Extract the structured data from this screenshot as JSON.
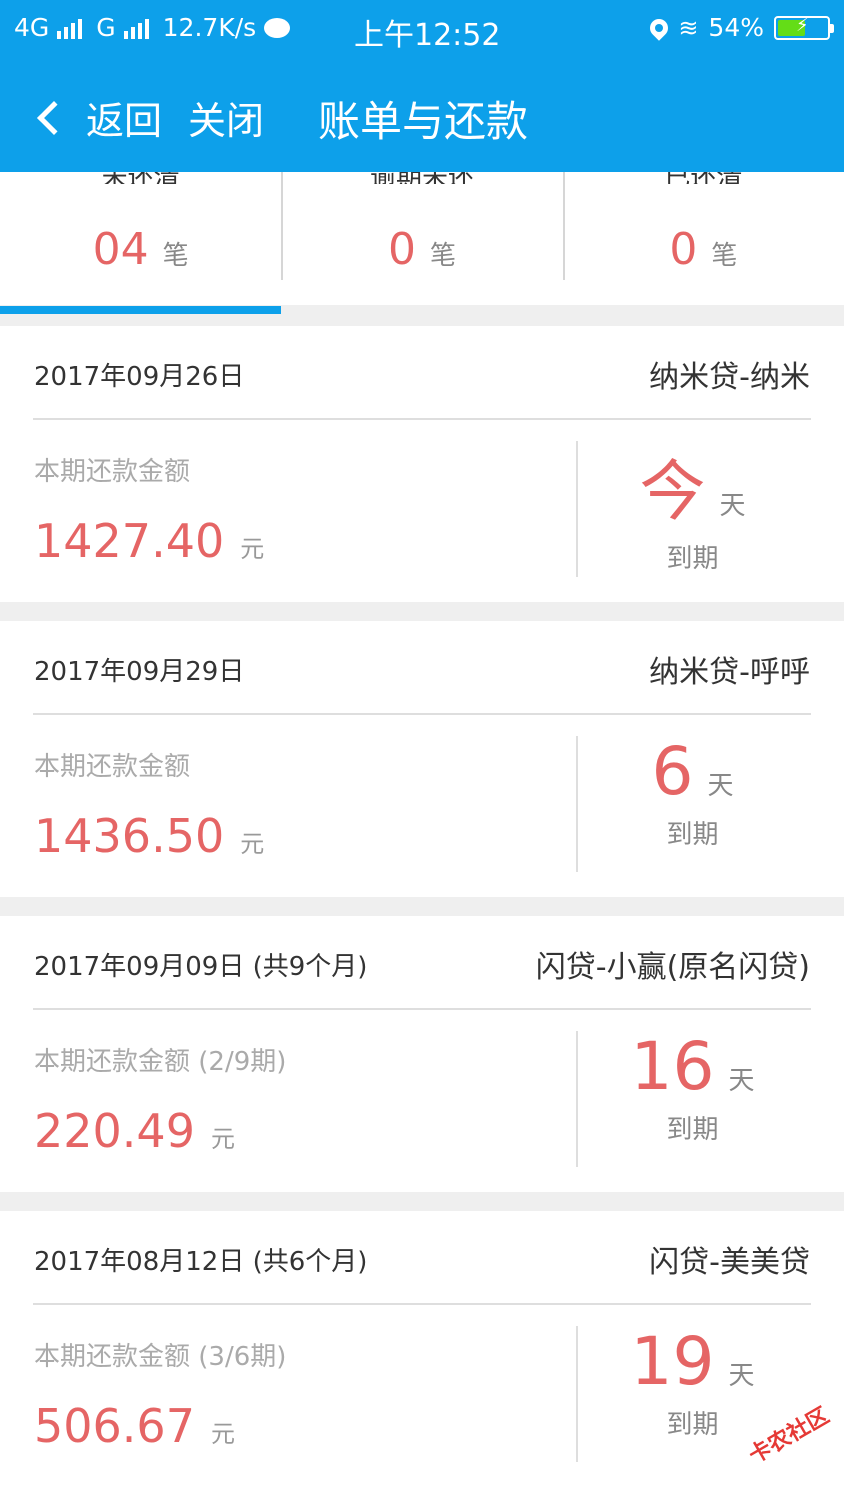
{
  "status_bar": {
    "network_1": "4G",
    "network_2": "G",
    "speed": "12.7K/s",
    "time": "上午12:52",
    "battery": "54%"
  },
  "nav": {
    "back": "返回",
    "close": "关闭",
    "title": "账单与还款"
  },
  "tabs": [
    {
      "label": "未还清",
      "count": "04",
      "unit": "笔"
    },
    {
      "label": "逾期未还",
      "count": "0",
      "unit": "笔"
    },
    {
      "label": "已还清",
      "count": "0",
      "unit": "笔"
    }
  ],
  "bills": [
    {
      "date": "2017年09月26日",
      "name": "纳米贷-纳米",
      "label": "本期还款金额",
      "amount": "1427.40",
      "unit": "元",
      "due": "今",
      "due_unit": "天",
      "due_label": "到期"
    },
    {
      "date": "2017年09月29日",
      "name": "纳米贷-呼呼",
      "label": "本期还款金额",
      "amount": "1436.50",
      "unit": "元",
      "due": "6",
      "due_unit": "天",
      "due_label": "到期"
    },
    {
      "date": "2017年09月09日 (共9个月)",
      "name": "闪贷-小赢(原名闪贷)",
      "label": "本期还款金额 (2/9期)",
      "amount": "220.49",
      "unit": "元",
      "due": "16",
      "due_unit": "天",
      "due_label": "到期"
    },
    {
      "date": "2017年08月12日 (共6个月)",
      "name": "闪贷-美美贷",
      "label": "本期还款金额 (3/6期)",
      "amount": "506.67",
      "unit": "元",
      "due": "19",
      "due_unit": "天",
      "due_label": "到期"
    }
  ],
  "watermark": "卡农社区",
  "colors": {
    "header": "#0da0ea",
    "accent": "#e56565"
  }
}
